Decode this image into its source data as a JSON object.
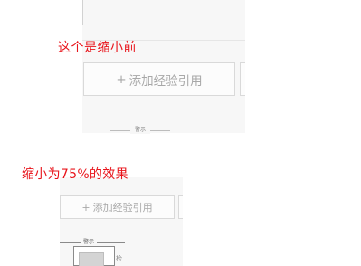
{
  "before": {
    "caption": "这个是缩小前",
    "add_button": {
      "plus": "+",
      "label": "添加经验引用"
    },
    "mini_tab": "警示"
  },
  "after": {
    "caption": "缩小为75%的效果",
    "add_button": {
      "plus": "+",
      "label": "添加经验引用"
    },
    "mini_tab": "警示",
    "mini_side": "检"
  },
  "colors": {
    "caption": "#e8141b",
    "button_text": "#a8a8a8",
    "button_border": "#d9d9d9",
    "panel_bg": "#f7f7f7"
  }
}
